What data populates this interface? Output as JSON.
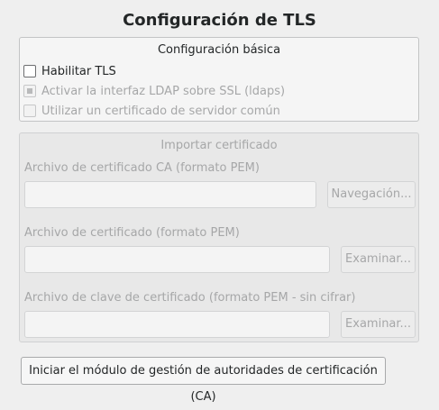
{
  "window": {
    "title": "Configuración de TLS"
  },
  "basic": {
    "title": "Configuración básica",
    "options": [
      {
        "label": "Habilitar TLS",
        "checked": false,
        "enabled": true
      },
      {
        "label": "Activar la interfaz LDAP sobre SSL (ldaps)",
        "checked": "partial",
        "enabled": false
      },
      {
        "label": "Utilizar un certificado de servidor común",
        "checked": false,
        "enabled": false
      }
    ]
  },
  "import": {
    "title": "Importar certificado",
    "enabled": false,
    "fields": [
      {
        "label": "Archivo de certificado CA (formato PEM)",
        "value": "",
        "button": "Navegación..."
      },
      {
        "label": "Archivo de certificado (formato PEM)",
        "value": "",
        "button": "Examinar..."
      },
      {
        "label": "Archivo de clave de certificado (formato PEM - sin cifrar)",
        "value": "",
        "button": "Examinar..."
      }
    ]
  },
  "actions": {
    "ca_manager_label": "Iniciar el módulo de gestión de autoridades de certificación (CA)"
  }
}
